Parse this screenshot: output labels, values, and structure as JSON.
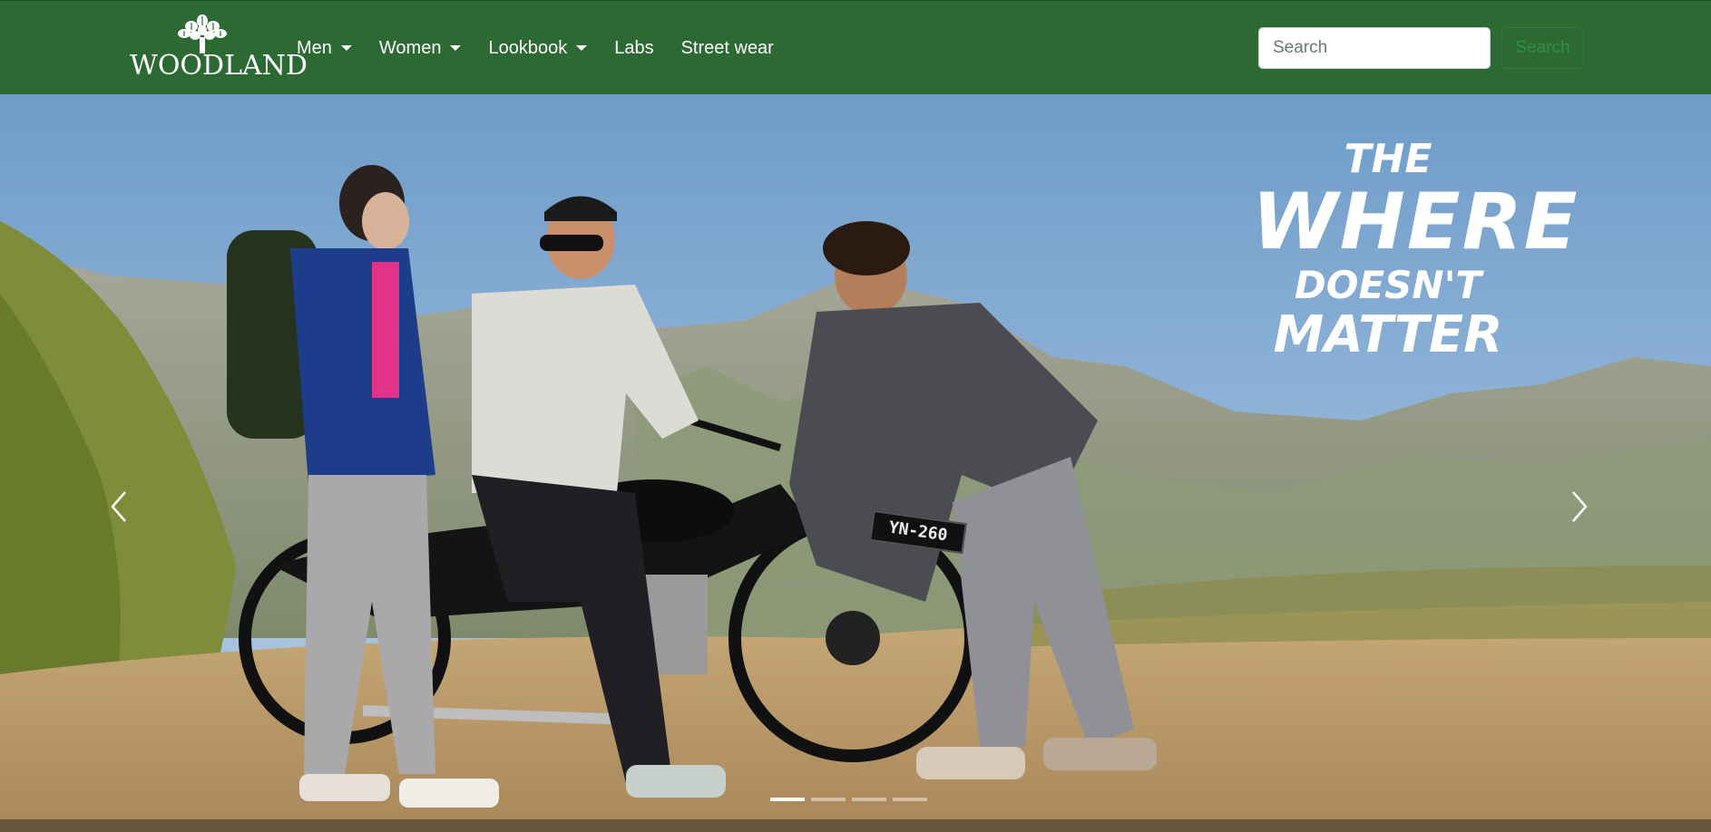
{
  "brand": {
    "logo_text": "WOODLAND"
  },
  "nav": {
    "items": [
      {
        "label": "Men",
        "has_dropdown": true
      },
      {
        "label": "Women",
        "has_dropdown": true
      },
      {
        "label": "Lookbook",
        "has_dropdown": true
      },
      {
        "label": "Labs",
        "has_dropdown": false
      },
      {
        "label": "Street wear",
        "has_dropdown": false
      }
    ]
  },
  "search": {
    "placeholder": "Search",
    "value": "",
    "button_label": "Search"
  },
  "carousel": {
    "slide_count": 4,
    "active_index": 0,
    "tagline": {
      "line1": "THE",
      "line2": "WHERE",
      "line3": "DOESN'T",
      "line4": "MATTER"
    },
    "license_plate": "YN-260"
  },
  "colors": {
    "navbar": "#2d6a33",
    "search_button": "#2f8f48"
  }
}
